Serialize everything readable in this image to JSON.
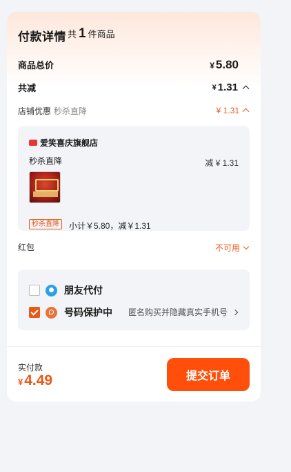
{
  "header": {
    "title": "付款详情",
    "count_prefix": "共",
    "count": "1",
    "count_suffix": "件商品"
  },
  "summary": {
    "total_label": "商品总价",
    "currency": "¥",
    "total_amount": "5.80",
    "discount_label": "共减",
    "discount_amount": "1.31"
  },
  "shop_discount": {
    "label": "店铺优惠",
    "sub_label": "秒杀直降",
    "amount": "¥ 1.31"
  },
  "shop": {
    "name": "爱笑喜庆旗舰店",
    "promo_label": "秒杀直降",
    "promo_amount": "减 ¥ 1.31",
    "tag": "秒杀直降",
    "subtotal": "小计￥5.80，减￥1.31"
  },
  "red_packet": {
    "label": "红包",
    "value": "不可用"
  },
  "options": [
    {
      "label": "朋友代付",
      "checked": false,
      "icon": "friend-pay-icon",
      "desc": ""
    },
    {
      "label": "号码保护中",
      "checked": true,
      "icon": "phone-protect-icon",
      "desc": "匿名购买并隐藏真实手机号"
    }
  ],
  "footer": {
    "pay_label": "实付款",
    "currency": "¥",
    "pay_amount": "4.49",
    "submit_label": "提交订单"
  },
  "colors": {
    "accent": "#ff4f0a",
    "accent_text": "#e85a1a",
    "page_bg": "#f2f4f7"
  }
}
